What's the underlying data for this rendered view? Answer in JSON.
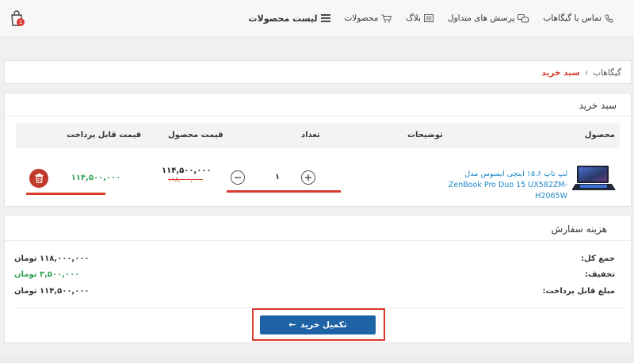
{
  "header": {
    "cart_badge": "1",
    "nav": {
      "products_list": "لیست محصولات",
      "products": "محصولات",
      "blog": "بلاگ",
      "faq": "پرسش های متداول",
      "contact": "تماس با گیگاهاب"
    }
  },
  "breadcrumb": {
    "home": "گیگاهاب",
    "separator": "‹",
    "current": "سبد خرید"
  },
  "cart": {
    "title": "سبد خرید",
    "columns": {
      "product": "محصول",
      "description": "توضیحات",
      "quantity": "تعداد",
      "price": "قیمت محصول",
      "payable": "قیمت قابل پرداخت"
    },
    "item": {
      "name": "لپ تاپ ۱۵.۶ اینچی ایسوس مدل ZenBook Pro Duo 15 UX582ZM-H2065W",
      "price": "۱۱۴,۵۰۰,۰۰۰",
      "old_price": "۱۱۸,۰۰۰,۰۰۰",
      "quantity": "۱",
      "payable": "۱۱۴,۵۰۰,۰۰۰"
    }
  },
  "order": {
    "title": "هزینه سفارش",
    "total_label": "جمع کل:",
    "total_value": "۱۱۸,۰۰۰,۰۰۰ تومان",
    "discount_label": "تخفیف:",
    "discount_value": "۳,۵۰۰,۰۰۰ تومان",
    "payable_label": "مبلغ قابل پرداخت:",
    "payable_value": "۱۱۴,۵۰۰,۰۰۰ تومان",
    "checkout_label": "تکمیل خرید",
    "checkout_arrow": "←"
  },
  "colors": {
    "accent_red": "#d93b2e",
    "primary_blue": "#1d63a5",
    "success_green": "#2ea44f",
    "link_blue": "#1e88c8"
  },
  "icons": [
    "shopping-bag-icon",
    "hamburger-icon",
    "cart-icon",
    "blog-icon",
    "faq-icon",
    "phone-icon",
    "plus-icon",
    "minus-icon",
    "trash-icon",
    "arrow-left-icon"
  ]
}
